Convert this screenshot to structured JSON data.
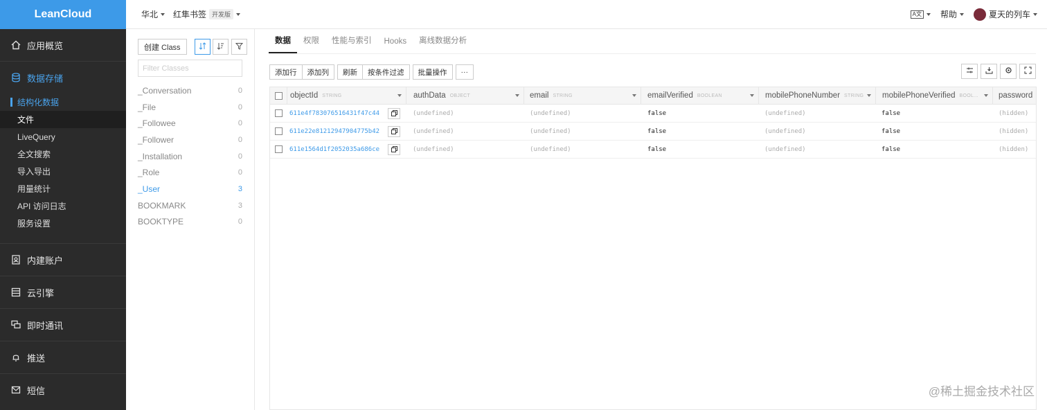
{
  "app": {
    "brand": "LeanCloud"
  },
  "sidebar": {
    "items": [
      {
        "label": "应用概览",
        "icon": "home-icon"
      },
      {
        "label": "数据存储",
        "icon": "database-icon",
        "children": [
          "结构化数据",
          "文件",
          "LiveQuery",
          "全文搜索",
          "导入导出",
          "用量统计",
          "API 访问日志",
          "服务设置"
        ]
      },
      {
        "label": "内建账户",
        "icon": "account-icon"
      },
      {
        "label": "云引擎",
        "icon": "server-icon"
      },
      {
        "label": "即时通讯",
        "icon": "chat-icon"
      },
      {
        "label": "推送",
        "icon": "bell-icon"
      },
      {
        "label": "短信",
        "icon": "mail-icon"
      }
    ]
  },
  "topbar": {
    "region": "华北",
    "app_name": "红隼书签",
    "plan_tag": "开发版",
    "lang": "A文",
    "help": "帮助",
    "user": "夏天的列车"
  },
  "classpanel": {
    "create_label": "创建 Class",
    "filter_placeholder": "Filter Classes",
    "classes": [
      {
        "name": "_Conversation",
        "count": "0"
      },
      {
        "name": "_File",
        "count": "0"
      },
      {
        "name": "_Followee",
        "count": "0"
      },
      {
        "name": "_Follower",
        "count": "0"
      },
      {
        "name": "_Installation",
        "count": "0"
      },
      {
        "name": "_Role",
        "count": "0"
      },
      {
        "name": "_User",
        "count": "3"
      },
      {
        "name": "BOOKMARK",
        "count": "3"
      },
      {
        "name": "BOOKTYPE",
        "count": "0"
      }
    ]
  },
  "tabs": [
    "数据",
    "权限",
    "性能与索引",
    "Hooks",
    "离线数据分析"
  ],
  "toolbar": {
    "add_row": "添加行",
    "add_col": "添加列",
    "refresh": "刷新",
    "filter": "按条件过滤",
    "batch": "批量操作",
    "more": "···"
  },
  "table": {
    "columns": [
      {
        "name": "objectId",
        "type": "STRING"
      },
      {
        "name": "authData",
        "type": "OBJECT"
      },
      {
        "name": "email",
        "type": "STRING"
      },
      {
        "name": "emailVerified",
        "type": "BOOLEAN"
      },
      {
        "name": "mobilePhoneNumber",
        "type": "STRING"
      },
      {
        "name": "mobilePhoneVerified",
        "type": "BOOL..."
      },
      {
        "name": "password",
        "type": ""
      }
    ],
    "rows": [
      [
        "611e4f783076516431f47c44",
        "(undefined)",
        "(undefined)",
        "false",
        "(undefined)",
        "false",
        "(hidden)"
      ],
      [
        "611e22e81212947904775b42",
        "(undefined)",
        "(undefined)",
        "false",
        "(undefined)",
        "false",
        "(hidden)"
      ],
      [
        "611e1564d1f2052035a686ce",
        "(undefined)",
        "(undefined)",
        "false",
        "(undefined)",
        "false",
        "(hidden)"
      ]
    ]
  },
  "watermark": "@稀土掘金技术社区"
}
